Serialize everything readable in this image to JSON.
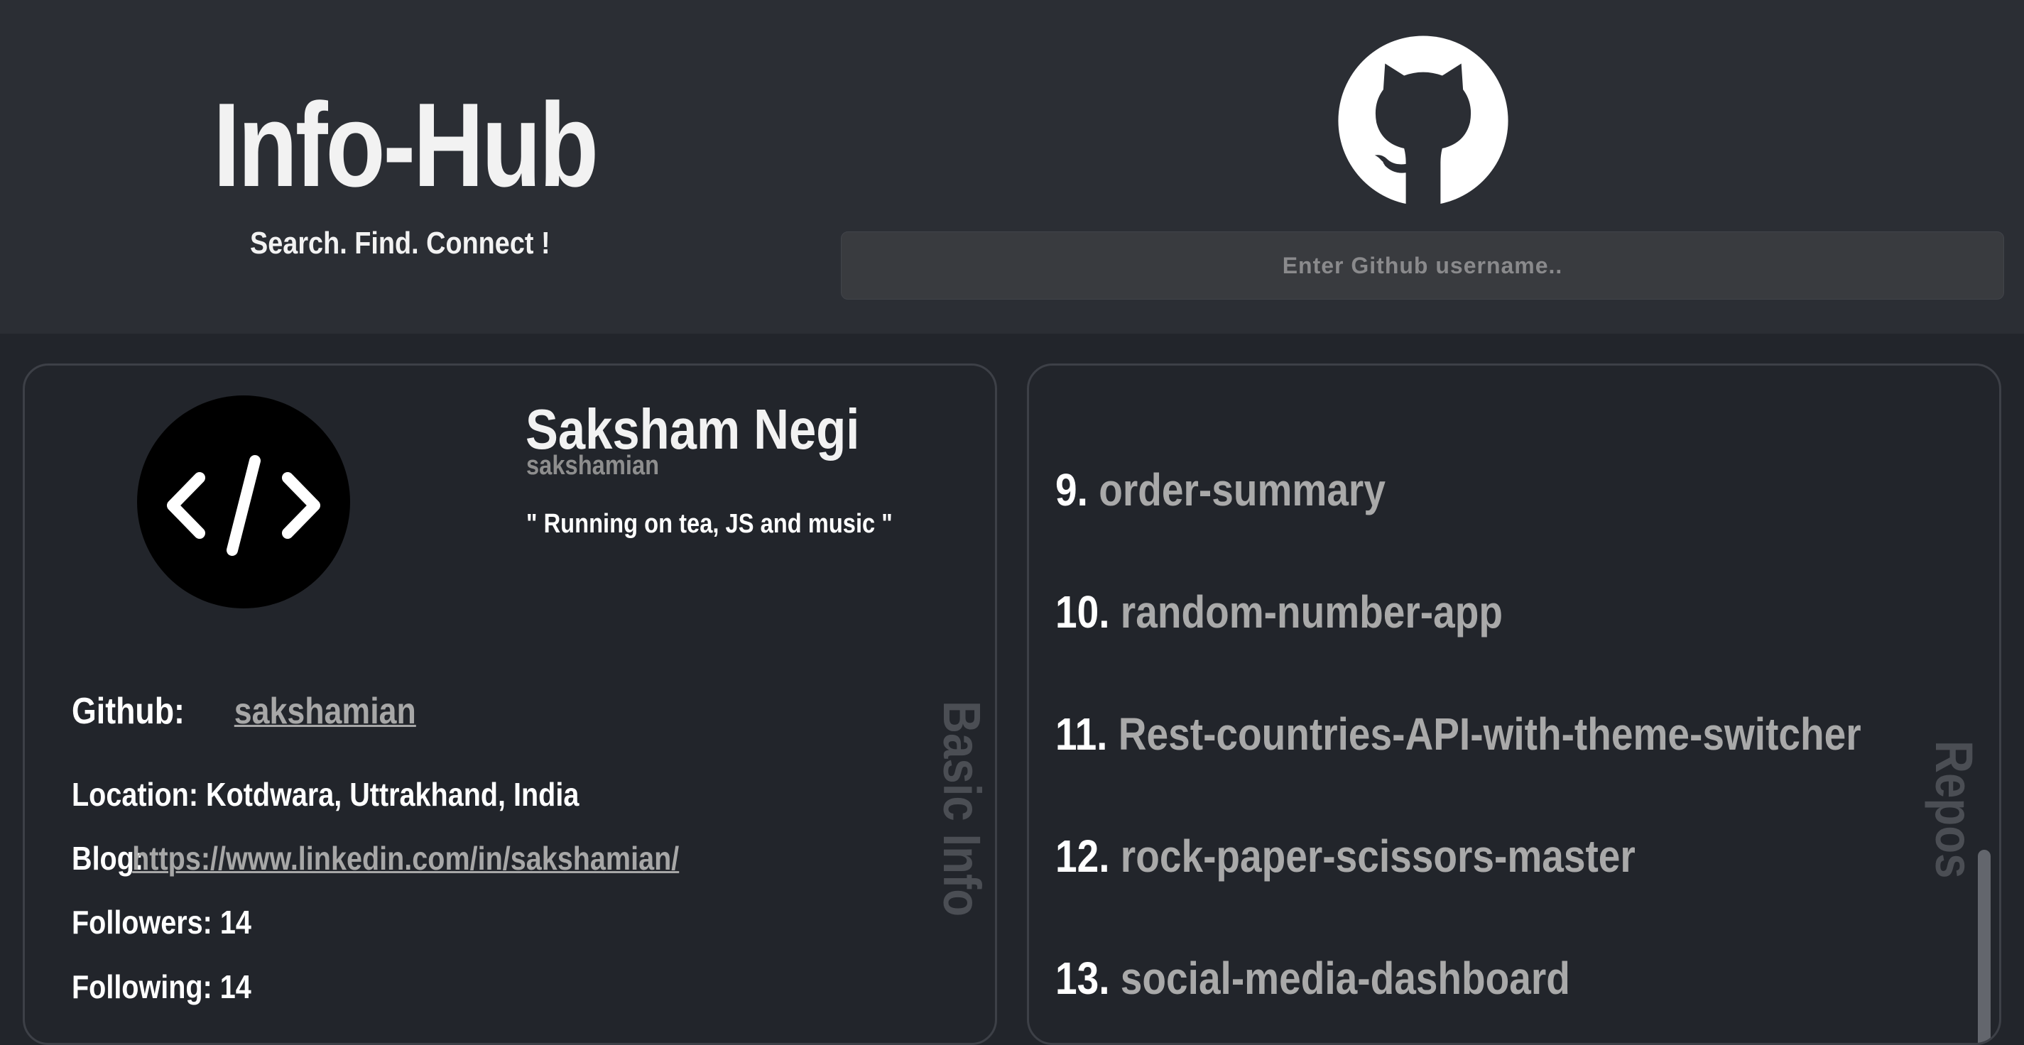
{
  "header": {
    "title": "Info-Hub",
    "tagline": "Search. Find. Connect !",
    "logo_icon": "github-octocat-icon",
    "search": {
      "placeholder": "Enter Github username..",
      "value": ""
    }
  },
  "profile": {
    "avatar_icon": "code-icon",
    "name": "Saksham Negi",
    "login": "sakshamian",
    "bio": "\" Running on tea, JS and music \"",
    "github_label": "Github:",
    "github_link": "sakshamian",
    "location_label": "Location:",
    "location": "Kotdwara, Uttrakhand, India",
    "blog_label": "Blog:",
    "blog_link": "https://www.linkedin.com/in/sakshamian/",
    "followers_label": "Followers:",
    "followers": "14",
    "following_label": "Following:",
    "following": "14",
    "side_label": "Basic Info"
  },
  "repos": {
    "side_label": "Repos",
    "items": [
      {
        "num": "9.",
        "name": "order-summary"
      },
      {
        "num": "10.",
        "name": "random-number-app"
      },
      {
        "num": "11.",
        "name": "Rest-countries-API-with-theme-switcher"
      },
      {
        "num": "12.",
        "name": "rock-paper-scissors-master"
      },
      {
        "num": "13.",
        "name": "social-media-dashboard"
      }
    ]
  },
  "colors": {
    "page_bg": "#22252b",
    "header_bg": "#2b2e34",
    "input_bg": "#393b3f",
    "link": "#a7a7a7",
    "side_label": "#4b4e54"
  }
}
